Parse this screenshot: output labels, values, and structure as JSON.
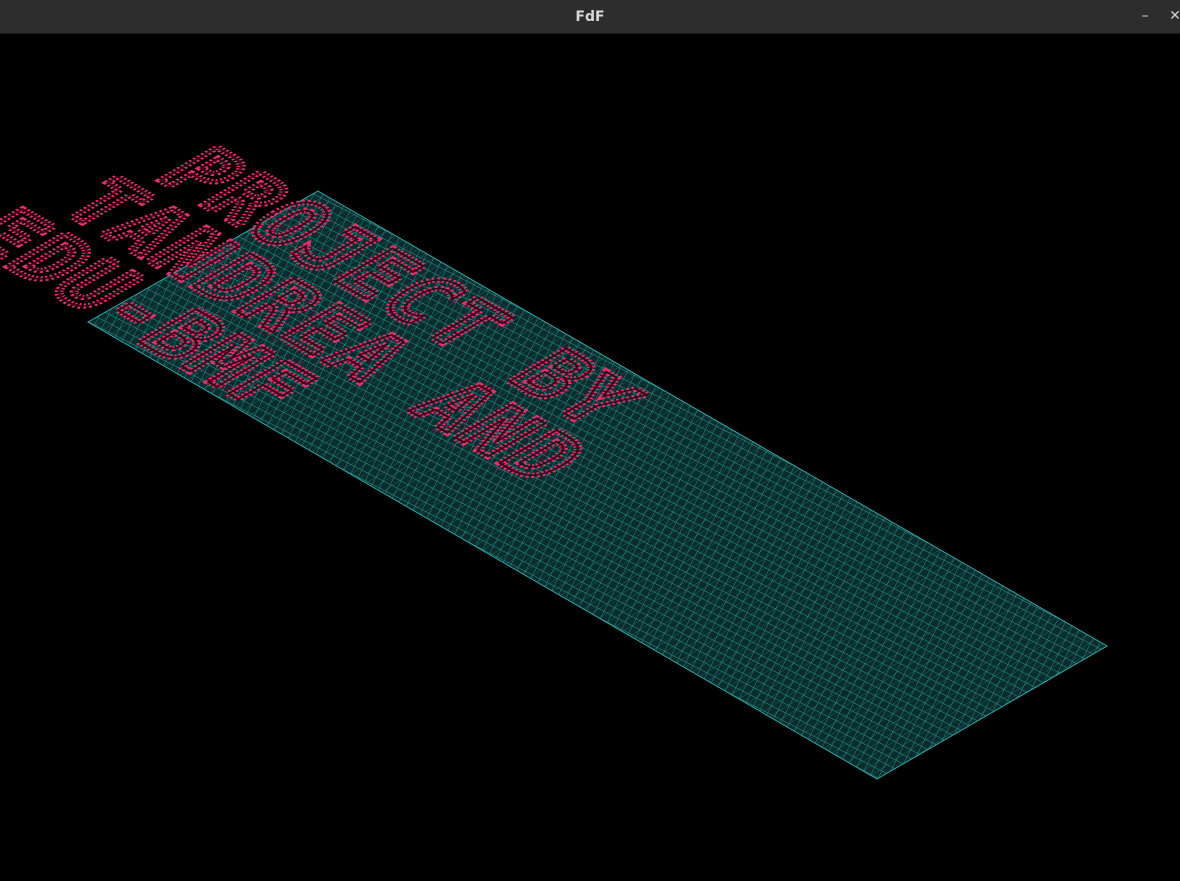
{
  "window": {
    "title": "FdF",
    "minimize_glyph": "–",
    "close_glyph": "✕"
  },
  "render": {
    "background_color": "#000000",
    "grid_color": "#2fa8a6",
    "raised_color": "#e0306e",
    "raised_dark_color": "#3a0616",
    "text_lines": [
      "PROJECT BY",
      "TANDREA AND",
      "EDU-BMF"
    ]
  }
}
